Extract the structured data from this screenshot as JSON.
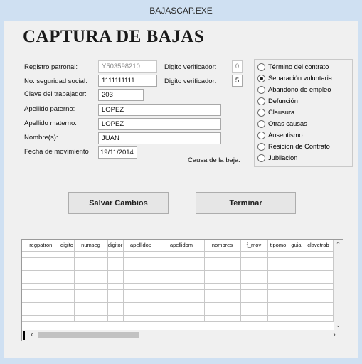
{
  "window": {
    "title": "BAJASCAP.EXE"
  },
  "heading": "CAPTURA DE BAJAS",
  "form": {
    "registro_patronal": {
      "label": "Registro patronal:",
      "value": "Y503598210"
    },
    "digito_verificador_1": {
      "label": "Digito verificador:",
      "value": "0"
    },
    "numero_seguridad_social": {
      "label": "No. seguridad social:",
      "value": "1111111111"
    },
    "digito_verificador_2": {
      "label": "Digito verificador:",
      "value": "5"
    },
    "clave_trabajador": {
      "label": "Clave del trabajador:",
      "value": "203"
    },
    "apellido_paterno": {
      "label": "Apellido paterno:",
      "value": "LOPEZ"
    },
    "apellido_materno": {
      "label": "Apellido materno:",
      "value": "LOPEZ"
    },
    "nombres": {
      "label": "Nombre(s):",
      "value": "JUAN"
    },
    "fecha_movimiento": {
      "label": "Fecha de movimiento",
      "value": "19/11/2014"
    },
    "causa_label": "Causa de la baja:"
  },
  "causas": {
    "selected": "Separación voluntaria",
    "options": [
      "Término del contrato",
      "Separación voluntaria",
      "Abandono de empleo",
      "Defunción",
      "Clausura",
      "Otras causas",
      "Ausentismo",
      "Resicion de Contrato",
      "Jubilacion"
    ]
  },
  "buttons": {
    "save": "Salvar Cambios",
    "exit": "Terminar"
  },
  "grid": {
    "columns": [
      "regpatron",
      "digito",
      "numseg",
      "digitor",
      "apellidop",
      "apellidom",
      "nombres",
      "f_mov",
      "tipomo",
      "guia",
      "clavetrab"
    ],
    "rows": [
      [],
      [],
      [],
      [],
      [],
      [],
      [],
      [],
      [],
      [],
      []
    ]
  }
}
